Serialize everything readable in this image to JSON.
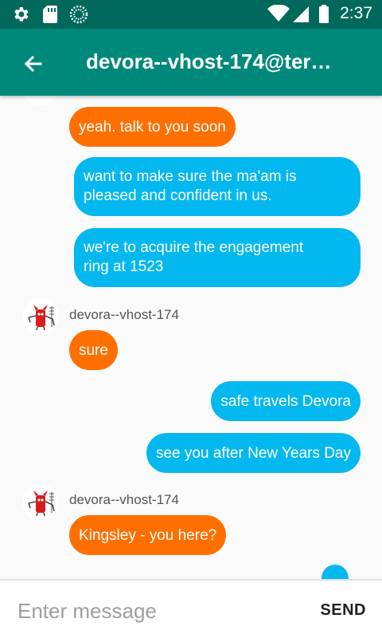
{
  "status_bar": {
    "time": "2:37",
    "icons": [
      "gear-icon",
      "sd-card-icon",
      "sync-icon",
      "wifi-icon",
      "cell-signal-icon",
      "battery-icon"
    ]
  },
  "app_bar": {
    "title": "devora--vhost-174@ter…",
    "back_icon": "arrow-back-icon"
  },
  "messages": [
    {
      "direction": "incoming",
      "text": "yeah. talk to you  soon"
    },
    {
      "direction": "outgoing",
      "lines": [
        "want to make sure the ma'am is",
        "pleased and confident in us."
      ]
    },
    {
      "direction": "outgoing",
      "lines": [
        "we're to acquire the engagement",
        "ring at 1523"
      ]
    },
    {
      "direction": "incoming",
      "sender": "devora--vhost-174",
      "text": "sure"
    },
    {
      "direction": "outgoing",
      "text": "safe travels Devora"
    },
    {
      "direction": "outgoing",
      "text": "see you after New Years Day"
    },
    {
      "direction": "incoming",
      "sender": "devora--vhost-174",
      "text": "Kingsley - you here?"
    }
  ],
  "input": {
    "placeholder": "Enter message",
    "value": "",
    "send_label": "SEND"
  },
  "colors": {
    "status_bar": "#00695c",
    "app_bar": "#00897b",
    "incoming_bubble": "#ff6f00",
    "outgoing_bubble": "#03b8ee"
  }
}
